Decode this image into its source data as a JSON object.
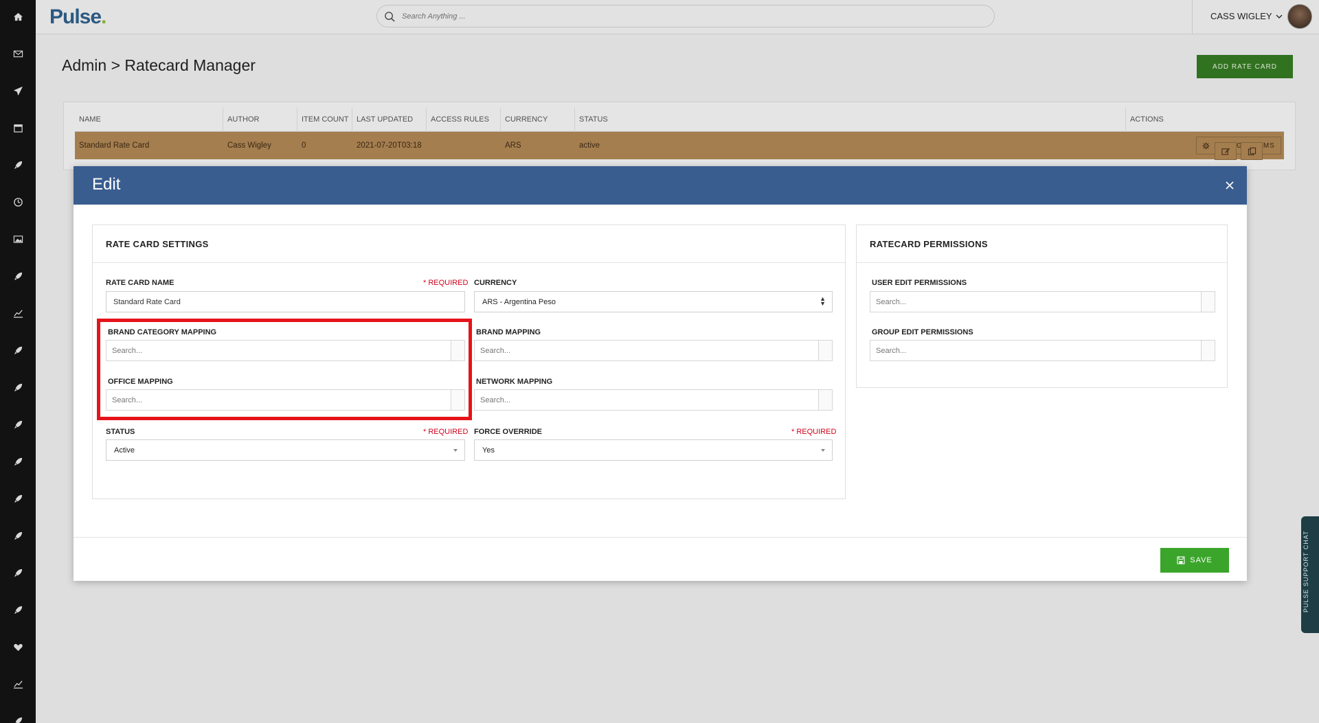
{
  "app": {
    "logo": "Pulse",
    "logo_dot": "."
  },
  "search": {
    "placeholder": "Search Anything ..."
  },
  "user": {
    "name": "CASS WIGLEY"
  },
  "sidebar": {
    "icons": [
      "home-icon",
      "mail-icon",
      "send-icon",
      "calendar-icon",
      "rocket-icon",
      "clock-icon",
      "image-icon",
      "rocket-icon",
      "chart-icon",
      "rocket-icon",
      "rocket-icon",
      "rocket-icon",
      "rocket-icon",
      "rocket-icon",
      "rocket-icon",
      "rocket-icon",
      "rocket-icon",
      "heart-icon",
      "trend-icon",
      "rocket-icon"
    ]
  },
  "page": {
    "title": "Admin > Ratecard Manager",
    "add_button": "ADD RATE CARD"
  },
  "table": {
    "headers": [
      "NAME",
      "AUTHOR",
      "ITEM COUNT",
      "LAST UPDATED",
      "ACCESS RULES",
      "CURRENCY",
      "STATUS",
      "ACTIONS"
    ],
    "row": {
      "name": "Standard Rate Card",
      "author": "Cass Wigley",
      "item_count": "0",
      "last_updated": "2021-07-20T03:18",
      "access_rules": "",
      "currency": "ARS",
      "status": "active"
    },
    "manage_items": "MANAGE ITEMS"
  },
  "modal": {
    "title": "Edit",
    "save": "SAVE",
    "settings": {
      "title": "RATE CARD SETTINGS",
      "required_label": "* REQUIRED",
      "rate_card_name_label": "RATE CARD NAME",
      "rate_card_name_value": "Standard Rate Card",
      "currency_label": "CURRENCY",
      "currency_value": "ARS - Argentina Peso",
      "brand_category_label": "BRAND CATEGORY MAPPING",
      "brand_mapping_label": "BRAND MAPPING",
      "office_mapping_label": "OFFICE MAPPING",
      "network_mapping_label": "NETWORK MAPPING",
      "search_placeholder": "Search...",
      "status_label": "STATUS",
      "status_value": "Active",
      "force_override_label": "FORCE OVERRIDE",
      "force_override_value": "Yes"
    },
    "permissions": {
      "title": "RATECARD PERMISSIONS",
      "user_edit_label": "USER EDIT PERMISSIONS",
      "group_edit_label": "GROUP EDIT PERMISSIONS",
      "search_placeholder": "Search..."
    }
  },
  "support_chat": {
    "label": "PULSE SUPPORT CHAT"
  },
  "colors": {
    "accent_blue": "#3a5d8f",
    "save_green": "#3aa52a",
    "add_green": "#357a22",
    "highlight_red": "#e6131a",
    "required_red": "#d0021b"
  }
}
